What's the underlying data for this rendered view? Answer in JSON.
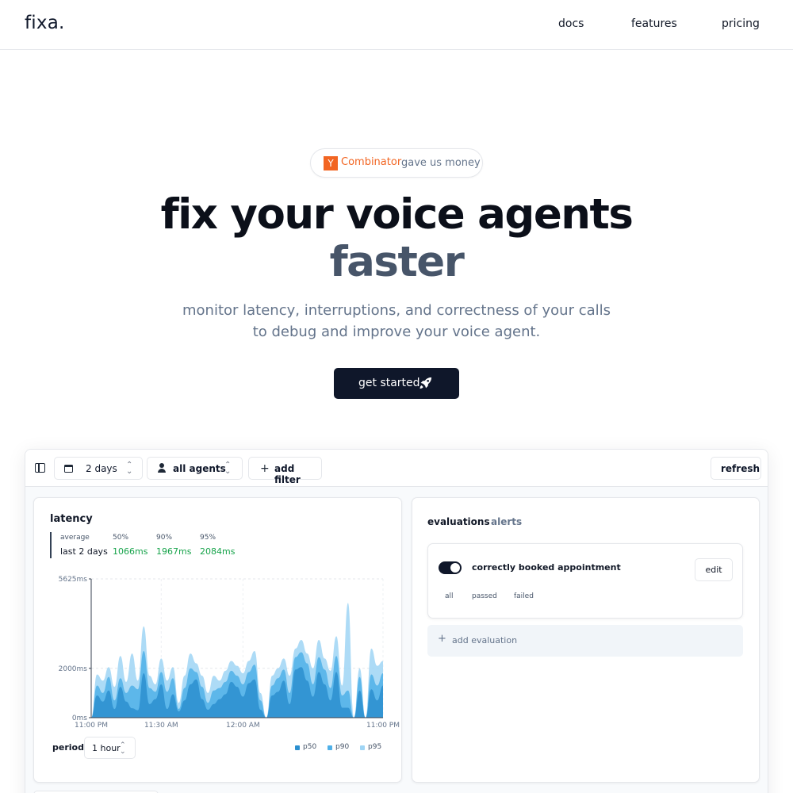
{
  "header": {
    "logo": "fixa.",
    "nav": [
      "docs",
      "features",
      "pricing"
    ]
  },
  "hero": {
    "badge": {
      "logo_letter": "Y",
      "brand": "Combinator",
      "text": "gave us money"
    },
    "title_line1": "fix your voice agents",
    "title_line2": "faster",
    "subtitle_line1": "monitor latency, interruptions, and correctness of your calls",
    "subtitle_line2": "to debug and improve your voice agent.",
    "cta_label": "get started",
    "cta_icon": "rocket-icon"
  },
  "dashboard": {
    "toolbar": {
      "date_range": "2 days",
      "agent_filter": "all agents",
      "add_filter": "add filter",
      "refresh": "refresh"
    },
    "latency": {
      "title": "latency",
      "stat_headers": [
        "average",
        "50%",
        "90%",
        "95%"
      ],
      "row_label": "last 2 days",
      "p50": "1066ms",
      "p90": "1967ms",
      "p95": "2084ms",
      "period_label": "period",
      "period_value": "1 hour",
      "legend": [
        "p50",
        "p90",
        "p95"
      ]
    },
    "evaluations": {
      "tabs": [
        "evaluations",
        "alerts"
      ],
      "item_name": "correctly booked appointment",
      "item_enabled": true,
      "edit_label": "edit",
      "filters": [
        "all",
        "passed",
        "failed"
      ],
      "add_label": "add evaluation"
    }
  },
  "colors": {
    "brand_dark": "#0f172a",
    "yc_orange": "#f26522",
    "p50": "#2b8fcf",
    "p90": "#4fb0e8",
    "p95": "#9fd5f5",
    "success": "#16a34a"
  },
  "chart_data": {
    "type": "area",
    "title": "latency",
    "xlabel": "",
    "ylabel": "",
    "y_ticks": [
      "5625ms",
      "2000ms",
      "0ms"
    ],
    "ylim": [
      0,
      5625
    ],
    "x_ticks": [
      "11:00 PM",
      "11:30 AM",
      "12:00 AM",
      "11:00 PM"
    ],
    "x_tick_positions": [
      0,
      24,
      52,
      100
    ],
    "x": [
      0,
      2,
      4,
      6,
      8,
      10,
      12,
      14,
      16,
      18,
      20,
      22,
      24,
      26,
      28,
      30,
      32,
      34,
      36,
      38,
      40,
      42,
      44,
      46,
      48,
      50,
      52,
      54,
      56,
      58,
      60,
      62,
      64,
      66,
      68,
      70,
      72,
      74,
      76,
      78,
      80,
      82,
      84,
      86,
      88,
      90,
      92,
      94,
      96,
      98,
      100
    ],
    "series": [
      {
        "name": "p50",
        "values": [
          0,
          900,
          650,
          1100,
          350,
          1250,
          650,
          380,
          300,
          1800,
          550,
          750,
          1350,
          350,
          950,
          250,
          700,
          1350,
          1550,
          750,
          320,
          550,
          750,
          950,
          1450,
          1250,
          850,
          1400,
          1550,
          320,
          0,
          900,
          1050,
          1500,
          550,
          1950,
          2050,
          1500,
          850,
          1850,
          1350,
          700,
          1850,
          400,
          400,
          0,
          1100,
          0,
          1150,
          700,
          1300
        ]
      },
      {
        "name": "p90",
        "values": [
          0,
          1300,
          1000,
          1650,
          700,
          1600,
          1000,
          1300,
          1150,
          2700,
          1200,
          1050,
          1850,
          1050,
          1600,
          350,
          1200,
          2000,
          1850,
          1250,
          600,
          1100,
          1200,
          1450,
          1900,
          1700,
          1350,
          1850,
          2150,
          700,
          0,
          1300,
          1600,
          1950,
          1000,
          2450,
          2650,
          2200,
          1350,
          2450,
          1950,
          1200,
          2500,
          900,
          1100,
          0,
          1650,
          0,
          1750,
          1300,
          1800
        ]
      },
      {
        "name": "p95",
        "values": [
          0,
          1750,
          1500,
          2050,
          1250,
          2500,
          1450,
          2600,
          1500,
          3700,
          1700,
          1350,
          2400,
          1500,
          2050,
          600,
          1700,
          2600,
          2200,
          1700,
          1000,
          1700,
          1500,
          1900,
          2300,
          2100,
          1800,
          2300,
          2700,
          1000,
          0,
          1700,
          2000,
          2400,
          1700,
          2800,
          3150,
          2600,
          2000,
          3150,
          2400,
          1900,
          3300,
          1300,
          4650,
          0,
          2000,
          0,
          2800,
          2100,
          2300
        ]
      }
    ],
    "legend_position": "bottom-right",
    "grid": true
  }
}
